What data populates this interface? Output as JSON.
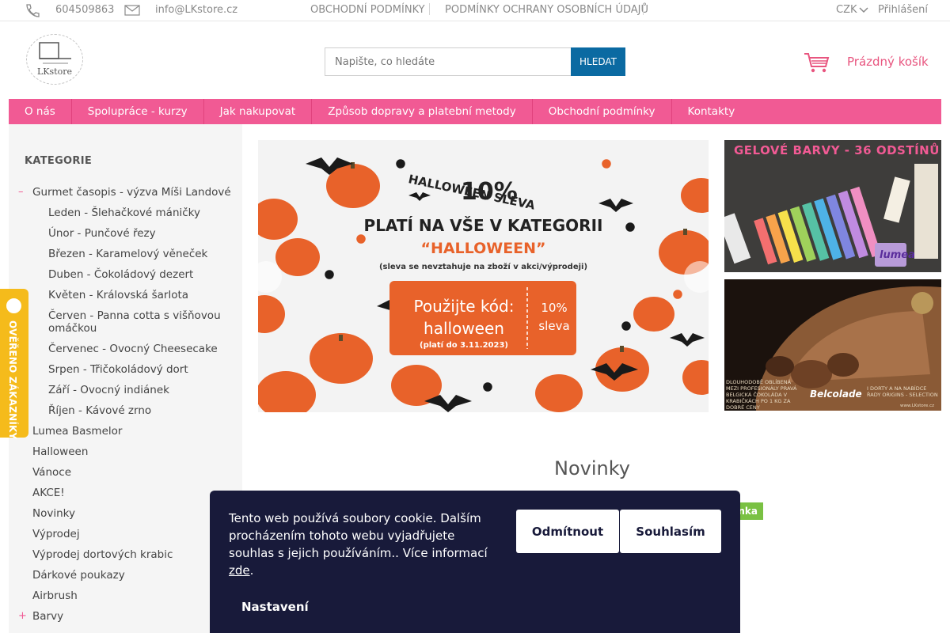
{
  "topbar": {
    "phone": "604509863",
    "email": "info@LKstore.cz",
    "links": [
      "OBCHODNÍ PODMÍNKY",
      "PODMÍNKY OCHRANY OSOBNÍCH ÚDAJŮ"
    ],
    "currency": "CZK",
    "login": "Přihlášení"
  },
  "header": {
    "logo_text": "LKstore",
    "search_placeholder": "Napište, co hledáte",
    "search_button": "HLEDAT",
    "cart_label": "Prázdný košík"
  },
  "nav": [
    "O nás",
    "Spolupráce - kurzy",
    "Jak nakupovat",
    "Způsob dopravy a platební metody",
    "Obchodní podmínky",
    "Kontakty"
  ],
  "sidebar": {
    "title": "KATEGORIE",
    "open_category": "Gurmet časopis - výzva Míši Landové",
    "subitems": [
      "Leden - Šlehačkové máničky",
      "Únor - Punčové řezy",
      "Březen - Karamelový věneček",
      "Duben - Čokoládový dezert",
      "Květen - Královská šarlota",
      "Červen - Panna cotta s višňovou omáčkou",
      "Červenec - Ovocný Cheesecake",
      "Srpen - Třičokoládový dort",
      "Září - Ovocný indiánek",
      "Říjen - Kávové zrno"
    ],
    "categories": [
      "Lumea Basmelor",
      "Halloween",
      "Vánoce",
      "AKCE!",
      "Novinky",
      "Výprodej",
      "Výprodej dortových krabic",
      "Dárkové poukazy",
      "Airbrush",
      "Barvy"
    ],
    "expanded_marker": "–",
    "collapsed_marker": "+"
  },
  "badge": {
    "text": "OVĚŘENO ZÁKAZNÍKY"
  },
  "banner": {
    "title": "HALLOWEEN SLEVA",
    "percent": "10%",
    "line1": "PLATÍ NA VŠE V KATEGORII",
    "line2": "“HALLOWEEN”",
    "note": "(sleva se nevztahuje na zboží v akci/výprodeji)",
    "code_label": "Použijte kód:",
    "code": "halloween",
    "valid": "(platí do 3.11.2023)",
    "ticket_percent": "10%",
    "ticket_word": "sleva"
  },
  "side_banner_1": {
    "title": "GELOVÉ BARVY - 36 ODSTÍNŮ",
    "brand": "lumea"
  },
  "side_banner_2": {
    "brand": "Belcolade",
    "left_caption": "DLOUHODOBĚ OBLÍBENÁ MEZI PROFESIONÁLY PRAVÁ BELGICKÁ ČOKOLÁDA V KRABIČKÁCH PO 1 KG ZA DOBRÉ CENY",
    "right_caption": "I DORTY A NA NABÍDCE ŘADY ORIGINS - SELECTION",
    "url": "www.LKstore.cz"
  },
  "section": {
    "title": "Novinky",
    "tag": "nka"
  },
  "cookie": {
    "text": "Tento web používá soubory cookie. Dalším procházením tohoto webu vyjadřujete souhlas s jejich používáním.. Více informací",
    "link": "zde",
    "reject": "Odmítnout",
    "accept": "Souhlasím",
    "settings": "Nastavení"
  },
  "colors": {
    "accent": "#f15a94",
    "button_blue": "#0b6aa2",
    "cookie_bg": "#181a3a",
    "badge": "#f5bb1b",
    "banner_orange": "#e8622a"
  }
}
